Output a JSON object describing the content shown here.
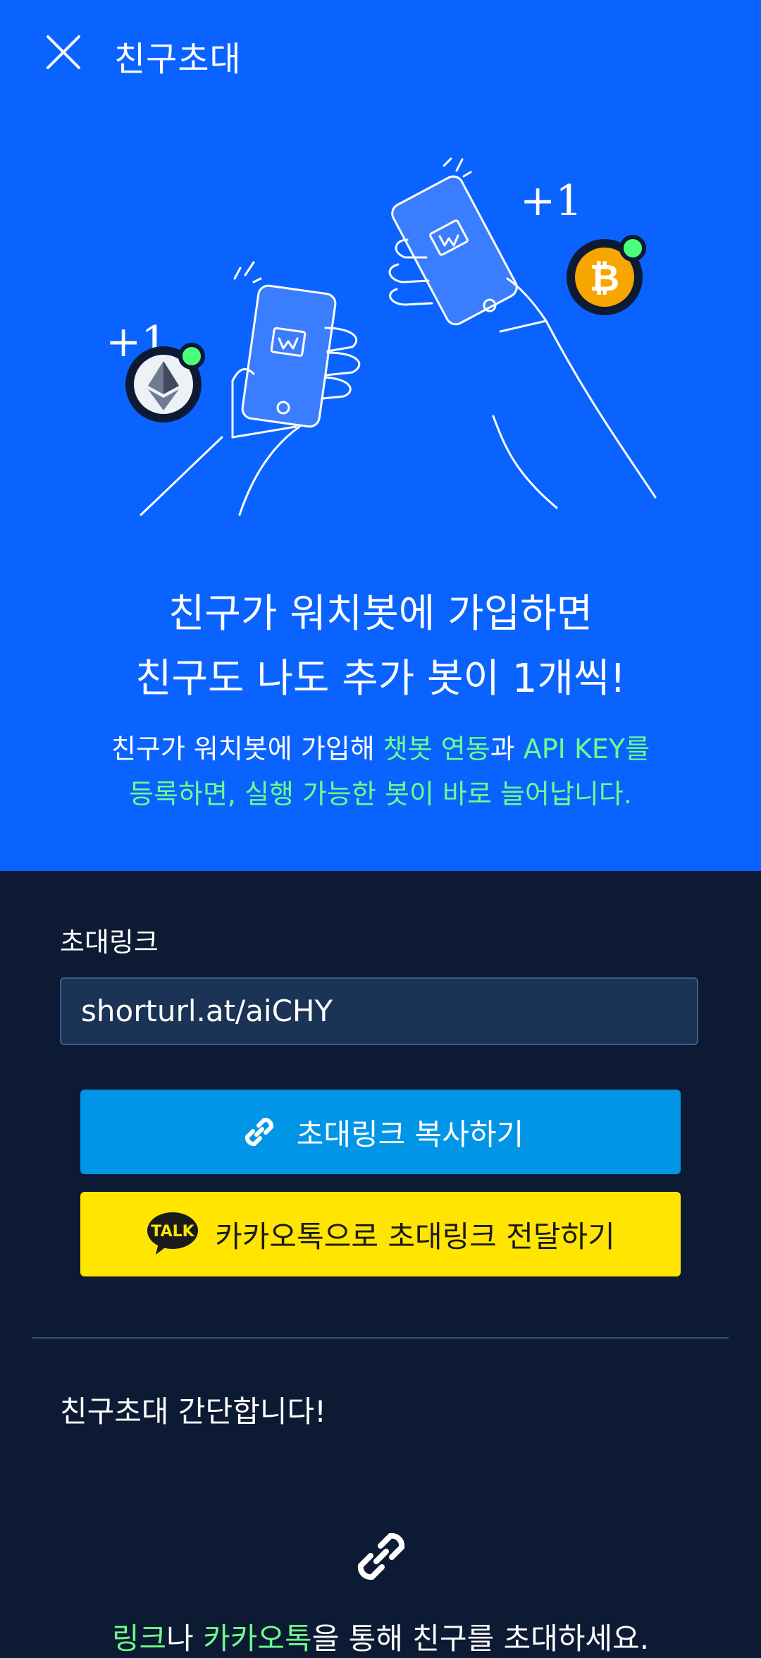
{
  "header": {
    "title": "친구초대"
  },
  "illustration": {
    "left_badge": "+1",
    "right_badge": "+1",
    "left_coin": "ethereum-icon",
    "right_coin": "bitcoin-icon"
  },
  "hero": {
    "headline_line1": "친구가 워치봇에 가입하면",
    "headline_line2": "친구도 나도 추가 봇이 1개씩!",
    "sub_part1": "친구가 워치봇에 가입해 ",
    "sub_hl1": "챗봇 연동",
    "sub_part2": "과 ",
    "sub_hl2": "API KEY를",
    "sub_line2": "등록하면, 실행 가능한 봇이 바로 늘어납니다."
  },
  "invite": {
    "label": "초대링크",
    "link_value": "shorturl.at/aiCHY",
    "copy_button": "초대링크 복사하기",
    "kakao_button": "카카오톡으로 초대링크 전달하기",
    "kakao_badge": "TALK"
  },
  "guide": {
    "title": "친구초대 간단합니다!",
    "step_hl1": "링크",
    "step_part1": "나 ",
    "step_hl2": "카카오톡",
    "step_part2": "을 통해 친구를 초대하세요."
  },
  "colors": {
    "hero_bg": "#0a63ff",
    "page_bg": "#0d1a33",
    "highlight": "#6cff8a",
    "copy_button": "#0095e6",
    "kakao_button": "#ffe500"
  }
}
